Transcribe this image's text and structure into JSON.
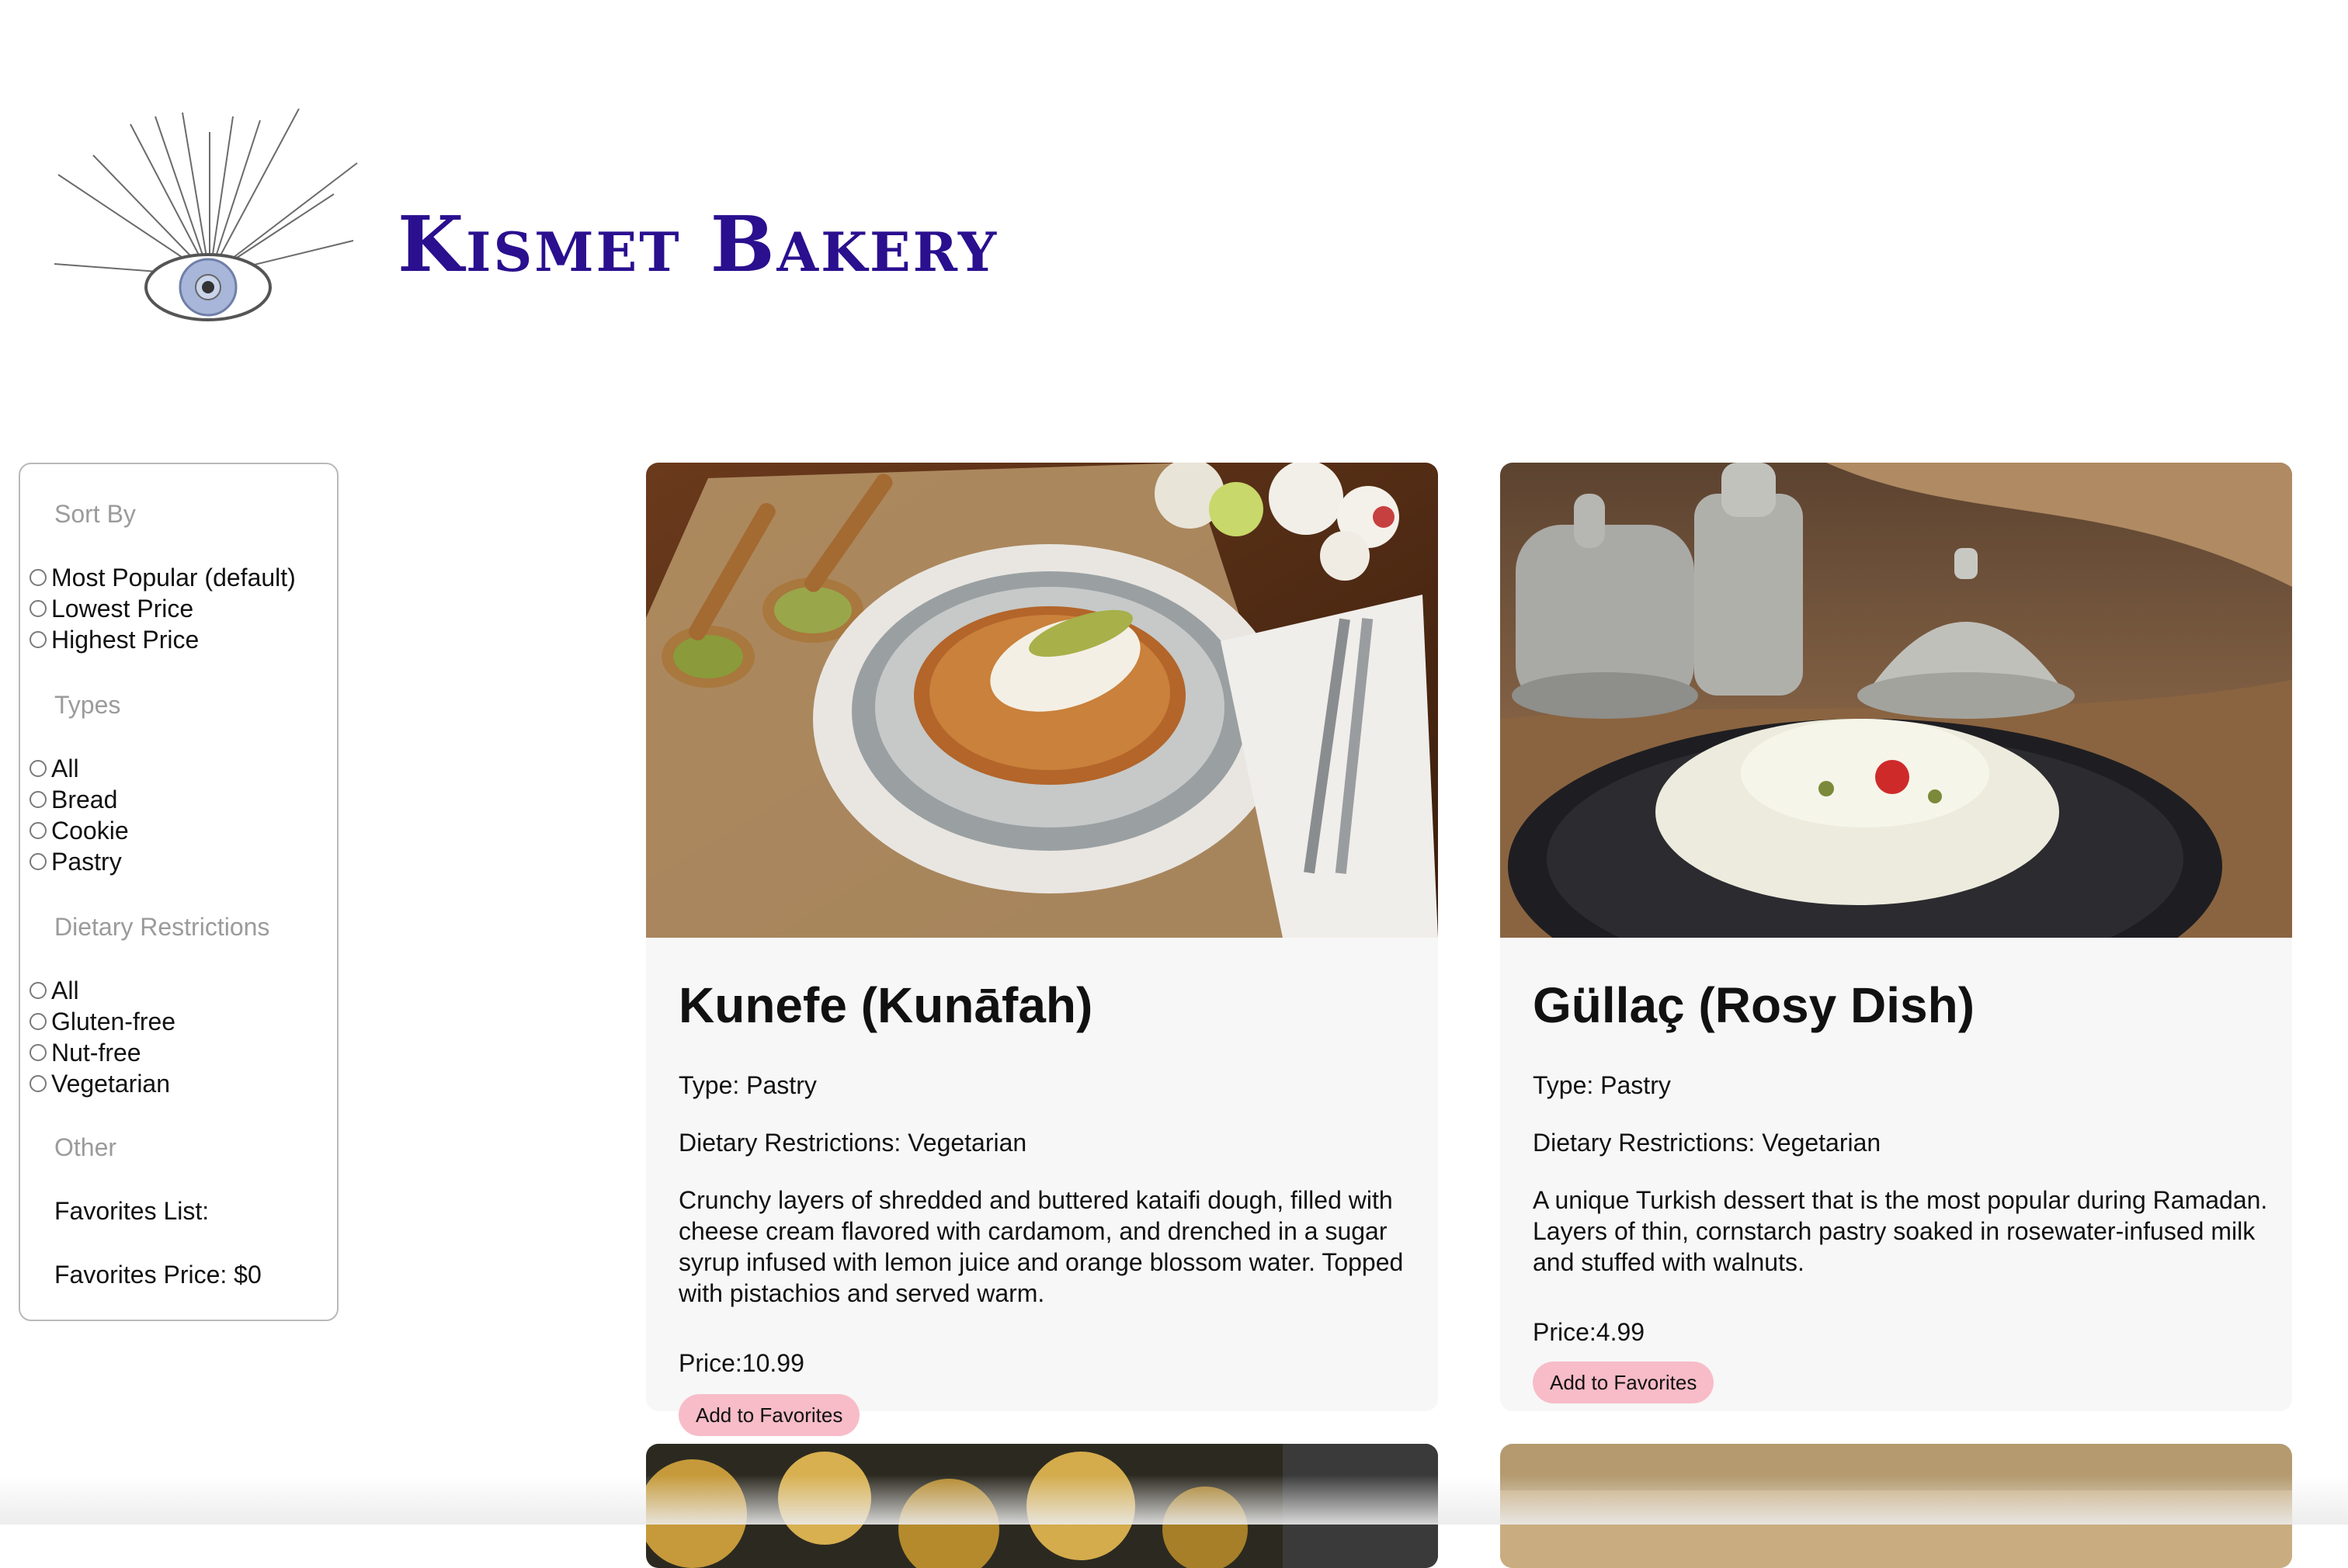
{
  "brand": {
    "name": "Kismet Bakery",
    "logo_icon": "evil-eye-icon"
  },
  "sidebar": {
    "sort_title": "Sort By",
    "sort_options": [
      "Most Popular (default)",
      "Lowest Price",
      "Highest Price"
    ],
    "types_title": "Types",
    "type_options": [
      "All",
      "Bread",
      "Cookie",
      "Pastry"
    ],
    "dietary_title": "Dietary Restrictions",
    "dietary_options": [
      "All",
      "Gluten-free",
      "Nut-free",
      "Vegetarian"
    ],
    "other_title": "Other",
    "favorites_list": "Favorites List:",
    "favorites_price": "Favorites Price: $0"
  },
  "items": [
    {
      "name": "Kunefe (Kunāfah)",
      "type": "Type: Pastry",
      "dietary": "Dietary Restrictions: Vegetarian",
      "description": "Crunchy layers of shredded and buttered kataifi dough, filled with cheese cream flavored with cardamom, and drenched in a sugar syrup infused with lemon juice and orange blossom water. Topped with pistachios and served warm.",
      "price": "Price:10.99",
      "button": "Add to Favorites"
    },
    {
      "name": "Güllaç (Rosy Dish)",
      "type": "Type: Pastry",
      "dietary": "Dietary Restrictions: Vegetarian",
      "description": "A unique Turkish dessert that is the most popular during Ramadan. Layers of thin, cornstarch pastry soaked in rosewater-infused milk and stuffed with walnuts.",
      "price": "Price:4.99",
      "button": "Add to Favorites"
    }
  ],
  "colors": {
    "brand": "#2a0f8f",
    "button": "#f7bcc8",
    "card_bg": "#f7f7f7"
  }
}
